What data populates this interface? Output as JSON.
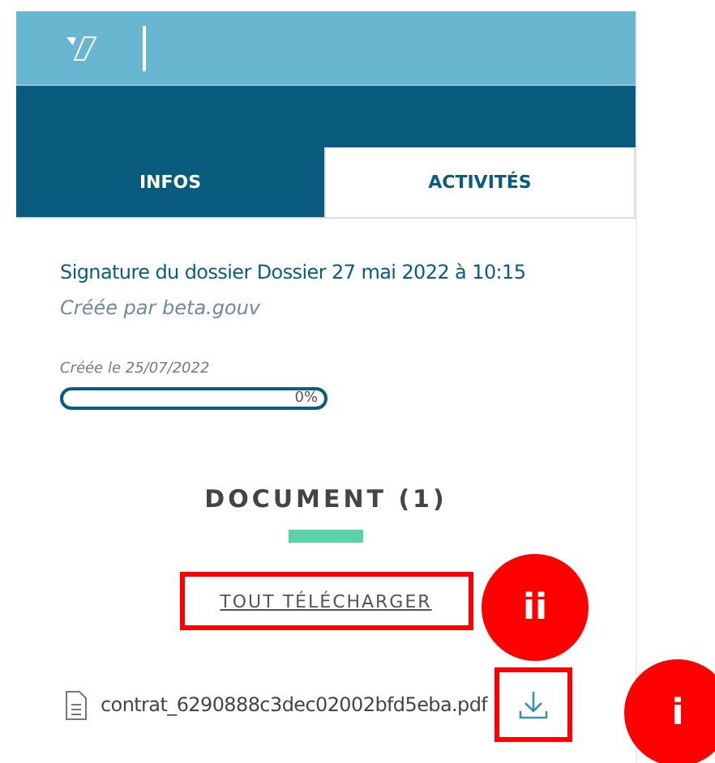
{
  "tabs": [
    {
      "label": "INFOS",
      "selected": true
    },
    {
      "label": "ACTIVITÉS",
      "selected": false
    }
  ],
  "request": {
    "title": "Signature du dossier Dossier 27 mai 2022 à 10:15",
    "author": "Créée par beta.gouv",
    "created": "Créée le 25/07/2022",
    "progress": {
      "reading": "0%"
    }
  },
  "documents": {
    "heading": "DOCUMENT (1)",
    "download_all": "TOUT TÉLÉCHARGER",
    "download_all_marker": "ii",
    "files": [
      {
        "name": "contrat_6290888c3dec02002bfd5eba.pdf",
        "marker": "i"
      }
    ]
  }
}
